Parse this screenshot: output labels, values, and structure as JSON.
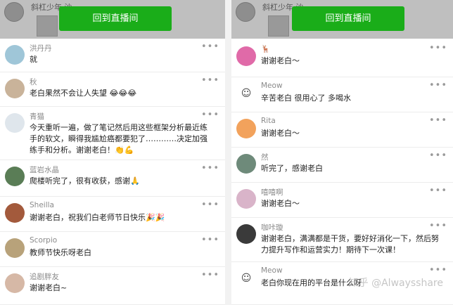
{
  "left": {
    "header_title": "斜杠少年·沙",
    "return_label": "回到直播间",
    "comments": [
      {
        "name": "洪丹丹",
        "text": "就",
        "avatar": "#9fc6d8"
      },
      {
        "name": "秋",
        "text": "老白果然不会让人失望 😂😂😂",
        "avatar": "#c9b39a"
      },
      {
        "name": "青猫",
        "text": "今天重听一遍，做了笔记然后用这些框架分析最近练手的软文，瞬得我尴尬癌都要犯了…………决定加强练手和分析。谢谢老白！👏💪",
        "avatar": "#dfe6ec"
      },
      {
        "name": "蓝岩水晶",
        "text": "爬楼听完了，很有收获，感谢🙏",
        "avatar": "#5a7d56"
      },
      {
        "name": "Sheilla",
        "text": "谢谢老白，祝我们白老师节日快乐🎉🎉",
        "avatar": "#a35a3c"
      },
      {
        "name": "Scorpio",
        "text": "教师节快乐呀老白",
        "avatar": "#b8a27a"
      },
      {
        "name": "追剧胖友",
        "text": "谢谢老白~",
        "avatar": "#d6b8a6"
      }
    ]
  },
  "right": {
    "header_title": "斜杠少年·沙",
    "return_label": "回到直播间",
    "comments": [
      {
        "name": "🦌",
        "text": "谢谢老白～",
        "avatar": "#e06aa8"
      },
      {
        "name": "Meow",
        "text": "辛苦老白 很用心了 多喝水",
        "avatar": "meow"
      },
      {
        "name": "Rita",
        "text": "谢谢老白～",
        "avatar": "#f2a25c"
      },
      {
        "name": "然",
        "text": "听完了，感谢老白",
        "avatar": "#6e8a7a"
      },
      {
        "name": "嘻嘻啊",
        "text": "谢谢老白～",
        "avatar": "#d9b4c9"
      },
      {
        "name": "咖咔璇",
        "text": "谢谢老白，满满都是干货，要好好消化一下，然后努力提升写作和运营实力！期待下一次课！",
        "avatar": "#3a3a3a"
      },
      {
        "name": "Meow",
        "text": "老白你现在用的平台是什么呀",
        "avatar": "meow"
      }
    ],
    "watermark": "知乎 @Alwaysshare"
  },
  "icons": {
    "more": "more-icon",
    "meow_face": "smiley-icon"
  },
  "colors": {
    "accent": "#1aad19"
  }
}
